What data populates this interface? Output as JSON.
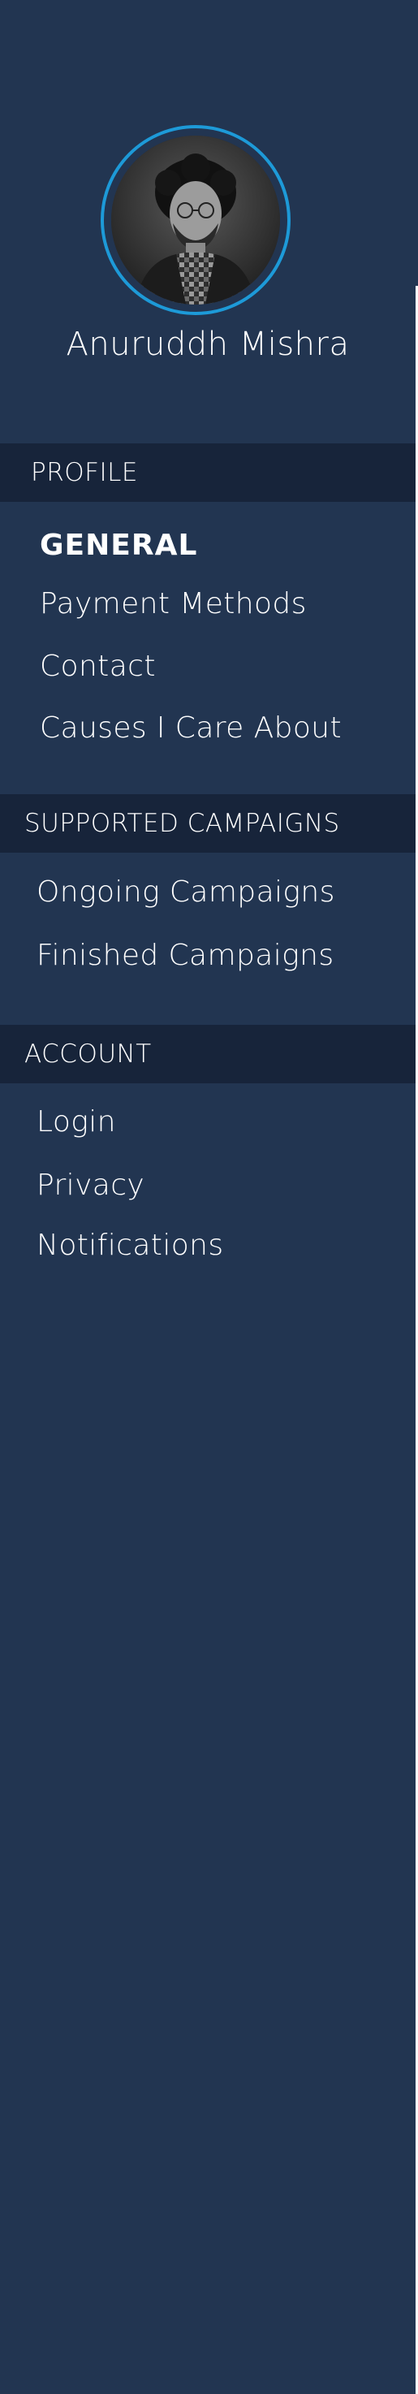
{
  "user": {
    "name": "Anuruddh Mishra"
  },
  "sections": {
    "profile": {
      "header": "PROFILE",
      "items": [
        "GENERAL",
        "Payment Methods",
        "Contact",
        "Causes I Care About"
      ],
      "active": "GENERAL"
    },
    "campaigns": {
      "header": "SUPPORTED CAMPAIGNS",
      "items": [
        "Ongoing Campaigns",
        "Finished Campaigns"
      ]
    },
    "account": {
      "header": "ACCOUNT",
      "items": [
        "Login",
        "Privacy",
        "Notifications"
      ]
    }
  },
  "colors": {
    "sidebar_bg": "#223551",
    "header_bg": "#17243a",
    "avatar_ring": "#1d9ad8",
    "text": "#ffffff"
  }
}
